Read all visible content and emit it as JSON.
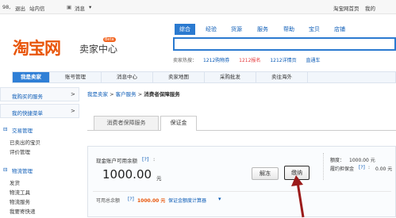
{
  "topbar": {
    "user": "98,",
    "logout": "退出",
    "station_msg": "站内信",
    "message": "消息",
    "taobao_home": "淘宝网首页",
    "my_taobao": "我的"
  },
  "brand": {
    "logo": "淘宝网",
    "subtitle": "卖家中心",
    "badge": "Beta"
  },
  "search": {
    "tabs": [
      "综合",
      "经验",
      "货源",
      "服务",
      "帮助",
      "宝贝",
      "店铺"
    ],
    "active_tab": "综合",
    "placeholder": "",
    "hot_label": "卖家热搜：",
    "hot_items": [
      "1212购物券",
      "1212报名",
      "1212详情页",
      "直通车"
    ],
    "hot_highlight": "1212报名"
  },
  "nav": {
    "items": [
      "我是卖家",
      "账号管理",
      "消息中心",
      "卖家地图",
      "采购批发",
      "卖往海外"
    ],
    "active": "我是卖家"
  },
  "sidebar": {
    "bought": "我购买的服务",
    "shortcuts": "我的快捷菜单",
    "groups": [
      {
        "title": "交易管理",
        "items": [
          "已卖出的宝贝",
          "评价管理"
        ]
      },
      {
        "title": "物流管理",
        "items": [
          "发货",
          "物流工具",
          "物流服务",
          "我要寄快递"
        ]
      }
    ],
    "chevron": "arrow-right-icon"
  },
  "breadcrumb": {
    "items": [
      "我是卖家",
      "客户服务"
    ],
    "current": "消费者保障服务",
    "separator": ">"
  },
  "content_tabs": {
    "items": [
      "消费者保障服务",
      "保证金"
    ],
    "active": "保证金"
  },
  "deposit": {
    "label": "现金账户可用余额",
    "help": "[?]",
    "colon": ":",
    "amount": "1000.00",
    "unit": "元",
    "unfreeze_button": "解冻",
    "pay_button": "缴纳",
    "quota_label": "额度：",
    "quota_value": "1000.00 元",
    "cover_label": "履约担保金",
    "cover_value": "0.00 元",
    "total_label": "可用总余额",
    "total_amount": "1000.00 元",
    "calculator": "保证金额度计算器"
  },
  "colors": {
    "brand_orange": "#e8550a",
    "accent_blue": "#2b7ad0",
    "link_blue": "#0b5bb6",
    "highlight_red": "#e4393c",
    "annotation_arrow": "#9b1b1b"
  }
}
